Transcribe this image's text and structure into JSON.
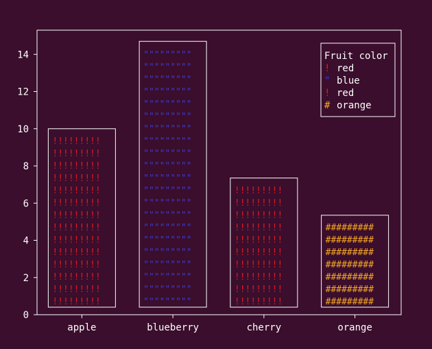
{
  "chart_data": {
    "type": "bar",
    "categories": [
      "apple",
      "blueberry",
      "cherry",
      "orange"
    ],
    "values": [
      10,
      14.7,
      7.35,
      5.35
    ],
    "bar_glyphs": [
      "!",
      "\"",
      "!",
      "#"
    ],
    "bar_colors": [
      "#e01b24",
      "#3b3bd8",
      "#e01b24",
      "#f5a623"
    ],
    "ylim": [
      0,
      15.3
    ],
    "yticks": [
      0,
      2,
      4,
      6,
      8,
      10,
      12,
      14
    ],
    "legend": {
      "title": "Fruit color",
      "placement": "top-right",
      "entries": [
        {
          "glyph": "!",
          "label": "red",
          "color": "#e01b24"
        },
        {
          "glyph": "\"",
          "label": "blue",
          "color": "#3b3bd8"
        },
        {
          "glyph": "!",
          "label": "red",
          "color": "#e01b24"
        },
        {
          "glyph": "#",
          "label": "orange",
          "color": "#f5a623"
        }
      ]
    },
    "background": "#3a0e2c",
    "axis_color": "#ffffff"
  }
}
